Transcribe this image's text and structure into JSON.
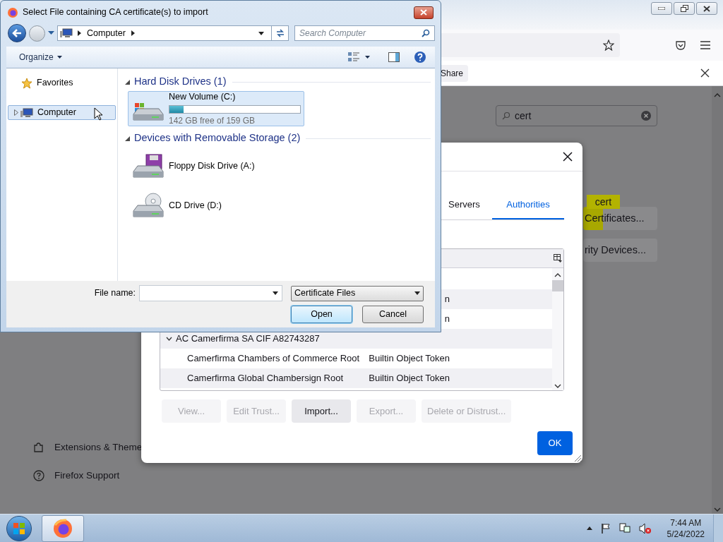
{
  "browser": {
    "notification": {
      "button": "Share"
    },
    "search": {
      "value": "cert"
    },
    "highlight_tooltip": "cert",
    "buttons": [
      {
        "label": "Certificates..."
      },
      {
        "label": "rity Devices..."
      }
    ],
    "sidebar": [
      {
        "kind": "extensions",
        "label": "Extensions & Theme"
      },
      {
        "kind": "support",
        "label": "Firefox Support"
      }
    ]
  },
  "cert_dialog": {
    "tabs": [
      {
        "label": "Servers",
        "selected": false
      },
      {
        "label": "Authorities",
        "selected": true
      }
    ],
    "rows": [
      {
        "kind": "cert",
        "token": "n"
      },
      {
        "kind": "cert",
        "token": "n"
      },
      {
        "kind": "group",
        "name": "AC Camerfirma SA CIF A82743287",
        "expanded": true
      },
      {
        "kind": "cert",
        "name": "Camerfirma Chambers of Commerce Root",
        "token": "Builtin Object Token"
      },
      {
        "kind": "cert",
        "name": "Camerfirma Global Chambersign Root",
        "token": "Builtin Object Token"
      }
    ],
    "actions": [
      {
        "label": "View...",
        "disabled": true
      },
      {
        "label": "Edit Trust...",
        "disabled": true
      },
      {
        "label": "Import...",
        "disabled": false
      },
      {
        "label": "Export...",
        "disabled": true
      },
      {
        "label": "Delete or Distrust...",
        "disabled": true
      }
    ],
    "ok": "OK"
  },
  "file_dialog": {
    "title": "Select File containing CA certificate(s) to import",
    "address": [
      "Computer"
    ],
    "search_placeholder": "Search Computer",
    "organize": "Organize",
    "nav": [
      {
        "kind": "favorites",
        "label": "Favorites",
        "selected": false
      },
      {
        "kind": "computer",
        "label": "Computer",
        "selected": true
      }
    ],
    "groups": [
      {
        "title": "Hard Disk Drives (1)",
        "expanded": true,
        "items": [
          {
            "kind": "hdd",
            "name": "New Volume (C:)",
            "level": 0.107,
            "detail": "142 GB free of 159 GB",
            "selected": true
          }
        ]
      },
      {
        "title": "Devices with Removable Storage (2)",
        "expanded": true,
        "items": [
          {
            "kind": "floppy",
            "name": "Floppy Disk Drive (A:)",
            "selected": false
          },
          {
            "kind": "cd",
            "name": "CD Drive (D:)",
            "selected": false
          }
        ]
      }
    ],
    "file_name_label": "File name:",
    "file_type": "Certificate Files",
    "buttons": [
      {
        "label": "Open",
        "default": true
      },
      {
        "label": "Cancel",
        "default": false
      }
    ]
  },
  "taskbar": {
    "apps": [
      {
        "kind": "firefox",
        "active": true
      }
    ],
    "time": "7:44 AM",
    "date": "5/24/2022"
  }
}
